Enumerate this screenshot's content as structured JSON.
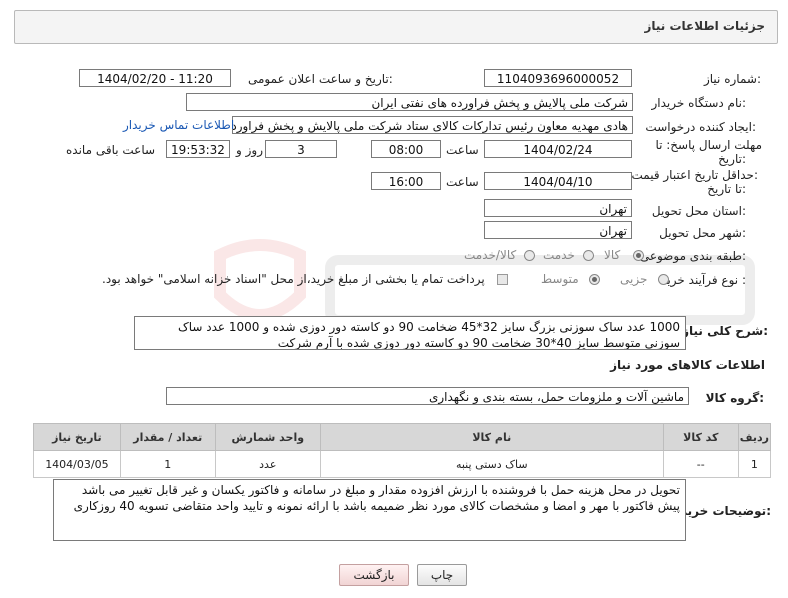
{
  "header": {
    "title": "جزئیات اطلاعات نیاز"
  },
  "fields": {
    "need_number_label": "شماره نیاز:",
    "need_number": "1104093696000052",
    "announce_label": "تاریخ و ساعت اعلان عمومی:",
    "announce_value": "1404/02/20 - 11:20",
    "buyer_org_label": "نام دستگاه خریدار:",
    "buyer_org": "شرکت ملی پالایش و پخش فراورده های نفتی ایران",
    "requester_label": "ایجاد کننده درخواست:",
    "requester": "هادی مهدیه معاون رئیس تدارکات کالای ستاد شرکت ملی پالایش و پخش فراورد",
    "buyer_contact_link": "اطلاعات تماس خریدار",
    "deadline_label_1": "مهلت ارسال پاسخ: تا",
    "deadline_label_2": "تاریخ:",
    "deadline_date": "1404/02/24",
    "time_label": "ساعت",
    "deadline_time": "08:00",
    "days_value": "3",
    "days_label": "روز و",
    "remaining_time": "19:53:32",
    "remaining_label": "ساعت باقی مانده",
    "validity_label_1": "حداقل تاریخ اعتبار قیمت:",
    "validity_label_2": "تا تاریخ:",
    "validity_date": "1404/04/10",
    "validity_time_label": "ساعت",
    "validity_time": "16:00",
    "province_label": "استان محل تحویل:",
    "province": "تهران",
    "city_label": "شهر محل تحویل:",
    "city": "تهران",
    "category_label": "طبقه بندی موضوعی:",
    "category_options": [
      "کالا",
      "خدمت",
      "کالا/خدمت"
    ],
    "category_selected": "کالا",
    "process_label": "نوع فرآیند خرید :",
    "process_options": [
      "جزیی",
      "متوسط"
    ],
    "process_selected": "متوسط",
    "payment_note": "پرداخت تمام یا بخشی از مبلغ خرید،از محل \"اسناد خزانه اسلامی\" خواهد بود."
  },
  "description": {
    "label": "شرح کلی نیاز:",
    "text": "1000 عدد ساک سوزنی بزرگ سایز 32*45 ضخامت 90 دو کاسته دور دوزی شده  و 1000 عدد ساک سوزنی متوسط سایز 40*30 ضخامت 90 دو کاسته دور دوزی شده با آرم شرکت"
  },
  "goods_section": {
    "title": "اطلاعات کالاهای مورد نیاز",
    "group_label": "گروه کالا:",
    "group_value": "ماشین آلات و ملزومات حمل، بسته بندی و نگهداری"
  },
  "table": {
    "headers": [
      "ردیف",
      "کد کالا",
      "نام کالا",
      "واحد شمارش",
      "تعداد / مقدار",
      "تاریخ نیاز"
    ],
    "rows": [
      {
        "row": "1",
        "code": "--",
        "name": "ساک دستی پنبه",
        "unit": "عدد",
        "qty": "1",
        "date": "1404/03/05"
      }
    ]
  },
  "buyer_notes": {
    "label": "توضیحات خریدار:",
    "text": "تحویل در محل هزینه حمل با فروشنده با ارزش افزوده مقدار و مبلغ در سامانه و فاکتور یکسان و غیر قابل تغییر می باشد پیش فاکتور با مهر و امضا و مشخصات کالای مورد نظر ضمیمه باشد با ارائه نمونه و تایید واحد متقاضی  تسویه 40 روزکاری"
  },
  "buttons": {
    "print": "چاپ",
    "back": "بازگشت"
  },
  "colors": {
    "link": "#1a58b4",
    "header_bg": "#f4f4f4",
    "table_header_bg": "#d7d7d7",
    "back_button": "#f1d4d4"
  },
  "icons": {
    "watermark": "shield-logo-icon"
  }
}
